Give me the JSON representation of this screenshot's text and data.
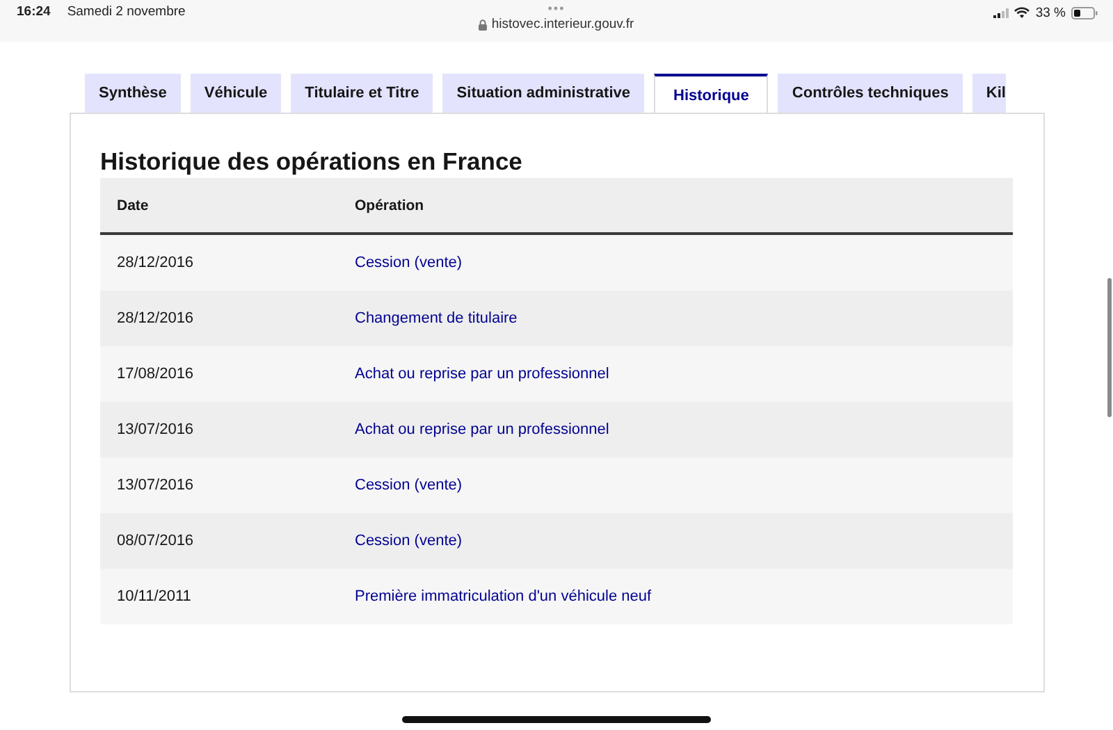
{
  "status_bar": {
    "time": "16:24",
    "date": "Samedi 2 novembre",
    "menu_dots": "•••",
    "url": "histovec.interieur.gouv.fr",
    "battery": "33 %"
  },
  "tabs": [
    {
      "label": "Synthèse",
      "selected": false
    },
    {
      "label": "Véhicule",
      "selected": false
    },
    {
      "label": "Titulaire et Titre",
      "selected": false
    },
    {
      "label": "Situation administrative",
      "selected": false
    },
    {
      "label": "Historique",
      "selected": true
    },
    {
      "label": "Contrôles techniques",
      "selected": false
    },
    {
      "label": "Kil",
      "selected": false
    }
  ],
  "section": {
    "title": "Historique des opérations en France"
  },
  "table": {
    "columns": [
      "Date",
      "Opération"
    ],
    "rows": [
      [
        "28/12/2016",
        "Cession (vente)"
      ],
      [
        "28/12/2016",
        "Changement de titulaire"
      ],
      [
        "17/08/2016",
        "Achat ou reprise par un professionnel"
      ],
      [
        "13/07/2016",
        "Achat ou reprise par un professionnel"
      ],
      [
        "13/07/2016",
        "Cession (vente)"
      ],
      [
        "08/07/2016",
        "Cession (vente)"
      ],
      [
        "10/11/2011",
        "Première immatriculation d'un véhicule neuf"
      ]
    ]
  }
}
